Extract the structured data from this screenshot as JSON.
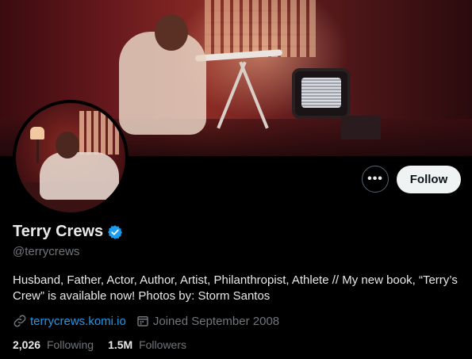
{
  "profile": {
    "display_name": "Terry Crews",
    "handle": "@terrycrews",
    "bio": "Husband, Father, Actor, Author, Artist, Philanthropist, Athlete // My new book, “Terry’s Crew” is available now! Photos by: Storm Santos",
    "website": "terrycrews.komi.io",
    "joined": "Joined September 2008",
    "following_count": "2,026",
    "following_label": "Following",
    "followers_count": "1.5M",
    "followers_label": "Followers",
    "verified": true
  },
  "actions": {
    "more_label": "•••",
    "follow_label": "Follow"
  },
  "icons": {
    "verified": "verified-badge-icon",
    "link": "link-icon",
    "calendar": "calendar-icon",
    "more": "more-icon"
  },
  "colors": {
    "background": "#000000",
    "text_primary": "#e7e9ea",
    "text_secondary": "#71767b",
    "accent": "#1d9bf0",
    "follow_bg": "#eff3f4"
  }
}
